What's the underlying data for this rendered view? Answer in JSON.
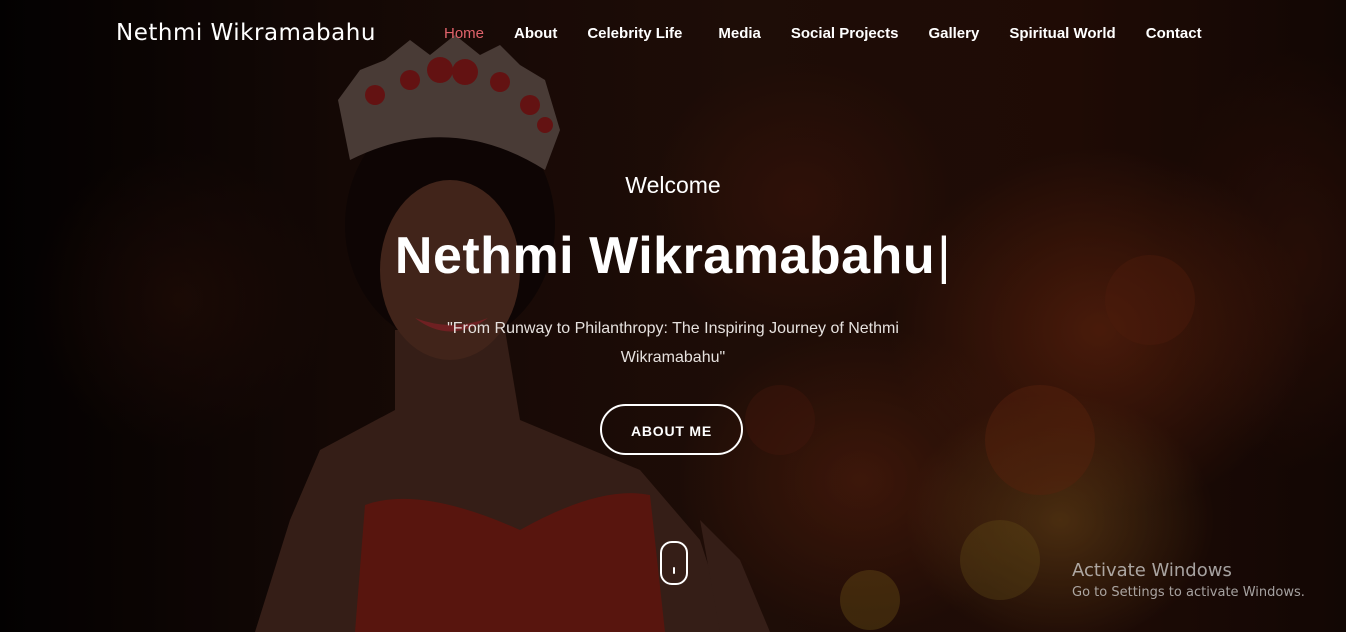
{
  "brand": "Nethmi Wikramabahu",
  "nav": {
    "items": [
      "Home",
      "About",
      "Celebrity Life",
      "Media",
      "Social Projects",
      "Gallery",
      "Spiritual World",
      "Contact"
    ],
    "active": "Home"
  },
  "hero": {
    "welcome": "Welcome",
    "title": "Nethmi Wikramabahu",
    "caret": "|",
    "tagline": "\"From Runway to Philanthropy: The Inspiring Journey of Nethmi Wikramabahu\"",
    "button_label": "ABOUT ME"
  },
  "os_watermark": {
    "line1": "Activate Windows",
    "line2": "Go to Settings to activate Windows."
  },
  "colors": {
    "active_nav": "#e0636b",
    "text": "#ffffff"
  }
}
